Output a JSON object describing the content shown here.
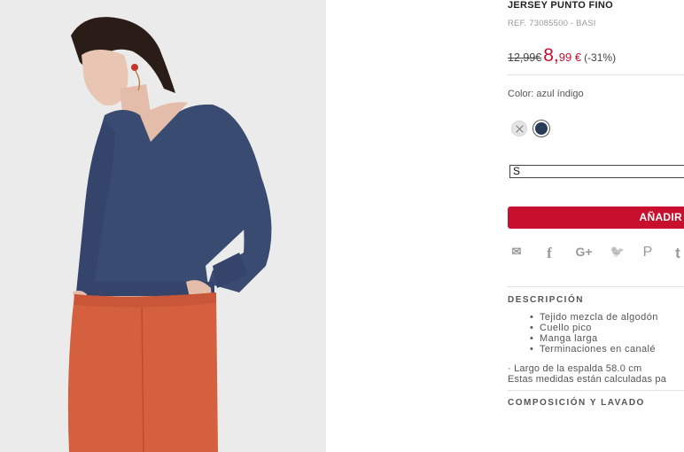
{
  "product": {
    "name": "JERSEY PUNTO FINO",
    "ref": "REF. 73085500 - BASI",
    "old_price": "12,99€",
    "new_price": "8,",
    "new_price_cents": "99 €",
    "discount": "(-31%)",
    "image_alt": "model wearing blue v-neck sweater and orange trousers"
  },
  "colors": {
    "label": "Color: azul índigo",
    "swatches": [
      {
        "name": "unavailable",
        "hex": "#e4e4e4"
      },
      {
        "name": "azul índigo",
        "hex": "#2c3a5a",
        "selected": true
      }
    ]
  },
  "size": {
    "selected": "S"
  },
  "add_button": {
    "label": "AÑADIR"
  },
  "share": {
    "icons": [
      "mail-icon",
      "facebook-icon",
      "google-plus-icon",
      "twitter-icon",
      "pinterest-icon",
      "tumblr-icon"
    ],
    "glyphs": [
      "✉",
      "f",
      "G+",
      "🐦",
      "P",
      "t"
    ]
  },
  "description": {
    "title": "DESCRIPCIÓN",
    "items": [
      "Tejido mezcla de algodón",
      "Cuello pico",
      "Manga larga",
      "Terminaciones en canalé"
    ],
    "measure_line1": "· Largo de la espalda 58.0 cm",
    "measure_line2": "Estas medidas están calculadas pa"
  },
  "composition": {
    "title": "COMPOSICIÓN Y LAVADO"
  },
  "theme": {
    "accent": "#c8102e",
    "sweater": "#3a4b72",
    "trousers": "#d4603f",
    "photo_bg": "#ebebeb"
  }
}
